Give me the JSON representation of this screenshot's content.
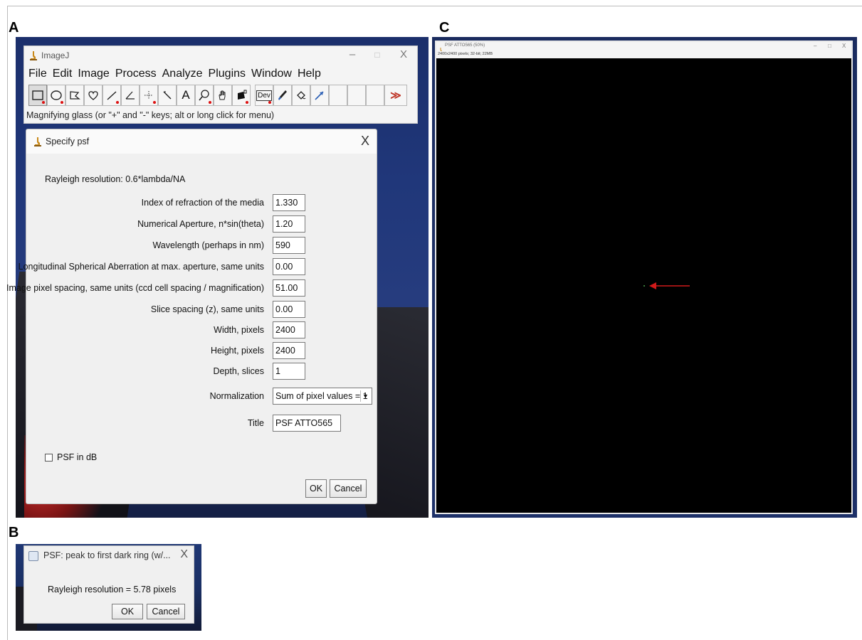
{
  "panels": {
    "a": "A",
    "b": "B",
    "c": "C"
  },
  "imagej": {
    "title": "ImageJ",
    "window_controls": {
      "minimize": "–",
      "maximize": "□",
      "close": "X"
    },
    "menu": [
      "File",
      "Edit",
      "Image",
      "Process",
      "Analyze",
      "Plugins",
      "Window",
      "Help"
    ],
    "tools": [
      "rectangle-tool",
      "oval-tool",
      "polygon-tool",
      "freehand-tool",
      "line-tool",
      "angle-tool",
      "point-tool",
      "wand-tool",
      "text-tool",
      "magnifier-tool",
      "scroll-tool",
      "color-picker-tool",
      "dev-tool",
      "brush-tool",
      "flood-fill-tool",
      "arrow-tool",
      "empty-tool",
      "empty-tool",
      "more-tools"
    ],
    "dev_label": "Dev",
    "more_label": "≫",
    "status": "Magnifying glass (or \"+\" and \"-\" keys; alt or long click for menu)"
  },
  "psf_dialog": {
    "title": "Specify psf",
    "close": "X",
    "rayleigh_note": "Rayleigh resolution: 0.6*lambda/NA",
    "fields": [
      {
        "label": "Index of refraction of the media",
        "value": "1.330"
      },
      {
        "label": "Numerical Aperture, n*sin(theta)",
        "value": "1.20"
      },
      {
        "label": "Wavelength (perhaps in nm)",
        "value": "590"
      },
      {
        "label": "Longitudinal Spherical Aberration at max. aperture, same units",
        "value": "0.00"
      },
      {
        "label": "Image pixel spacing, same units (ccd cell spacing / magnification)",
        "value": "51.00"
      },
      {
        "label": "Slice spacing (z), same units",
        "value": "0.00"
      },
      {
        "label": "Width, pixels",
        "value": "2400"
      },
      {
        "label": "Height, pixels",
        "value": "2400"
      },
      {
        "label": "Depth, slices",
        "value": "1"
      }
    ],
    "normalization": {
      "label": "Normalization",
      "value": "Sum of pixel values = 1"
    },
    "title_field": {
      "label": "Title",
      "value": "PSF ATTO565"
    },
    "checkbox": {
      "label": "PSF in dB",
      "checked": false
    },
    "ok": "OK",
    "cancel": "Cancel"
  },
  "result_dialog": {
    "title": "PSF: peak to first dark ring (w/...",
    "close": "X",
    "message": "Rayleigh resolution = 5.78 pixels",
    "ok": "OK",
    "cancel": "Cancel"
  },
  "image_window": {
    "title": "PSF ATTO565 (50%)",
    "info": "2400x2400 pixels; 32-bit; 22MB",
    "window_controls": {
      "minimize": "–",
      "maximize": "□",
      "close": "X"
    },
    "arrow_color": "#d01a1a"
  }
}
